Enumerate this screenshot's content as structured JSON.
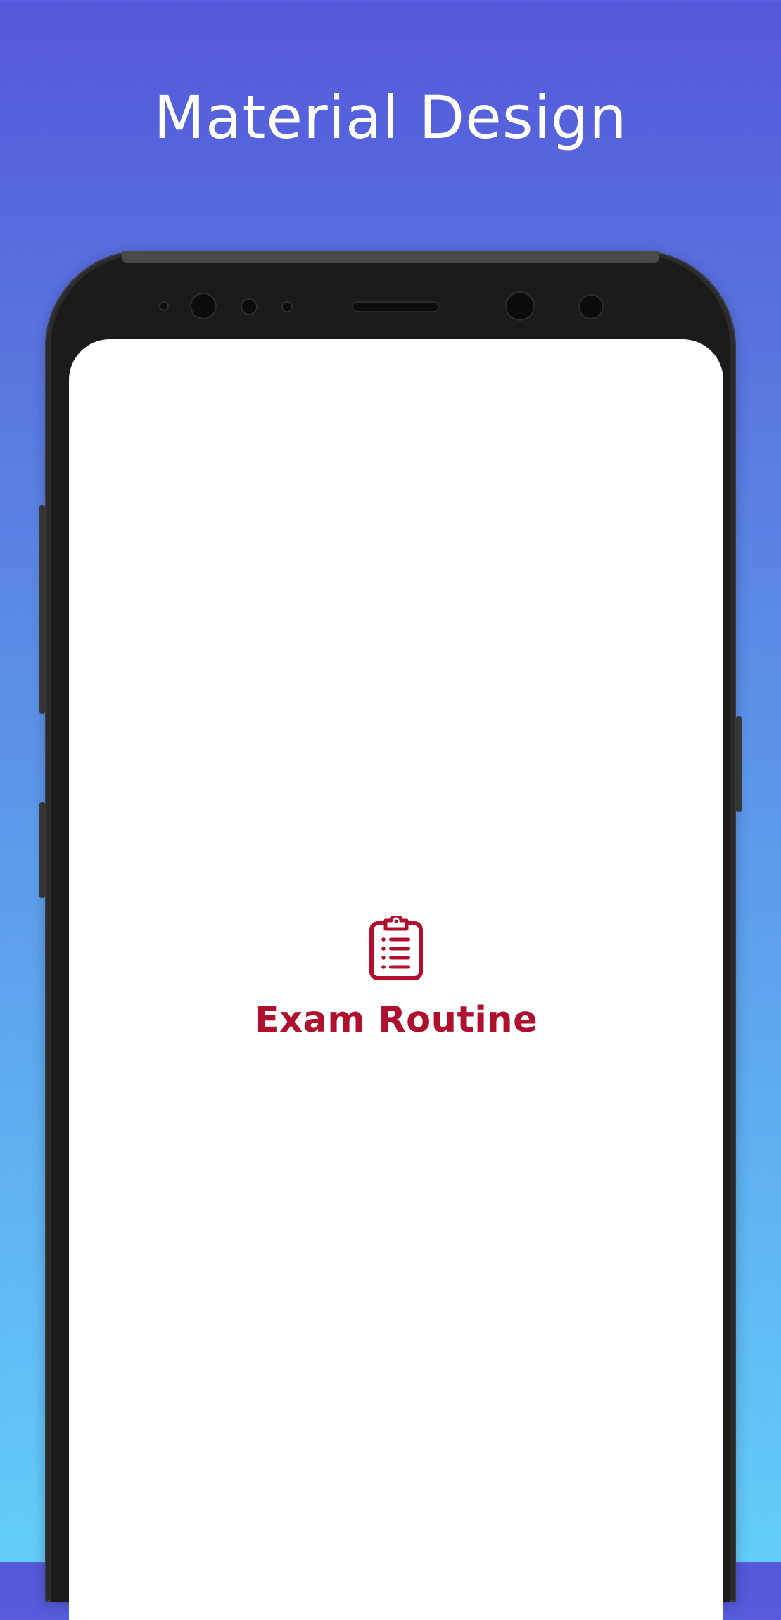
{
  "banner": {
    "headline": "Material Design"
  },
  "splash": {
    "app_name": "Exam Routine",
    "icon": "clipboard-list-icon"
  },
  "colors": {
    "gradient_top": "#5558da",
    "gradient_bottom": "#63cdfa",
    "brand": "#b0102e",
    "phone_frame": "#1b1b1b",
    "screen_bg": "#ffffff"
  }
}
